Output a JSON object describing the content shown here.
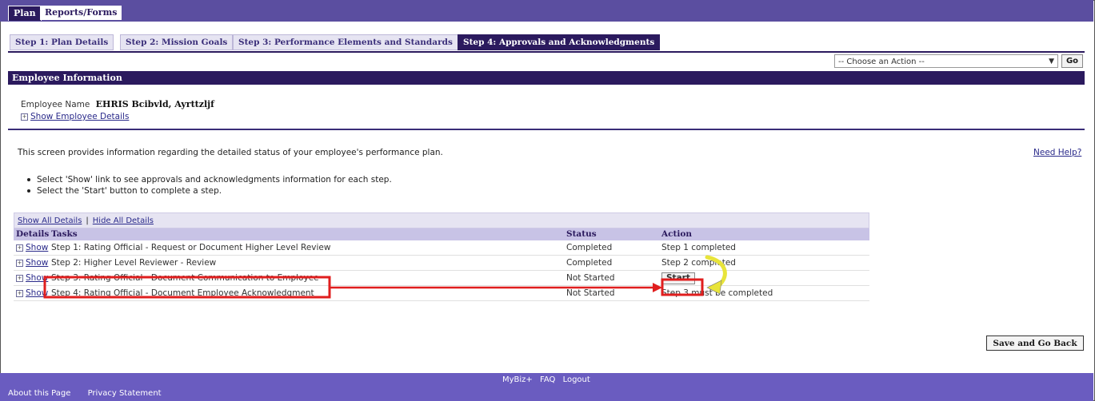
{
  "top_tabs": {
    "plan": "Plan",
    "reports": "Reports/Forms"
  },
  "step_tabs": [
    "Step 1: Plan Details",
    "Step 2: Mission Goals",
    "Step 3: Performance Elements and Standards",
    "Step 4: Approvals and Acknowledgments"
  ],
  "action_select": {
    "value": "-- Choose an Action --",
    "go_label": "Go"
  },
  "section_title": "Employee Information",
  "employee": {
    "label": "Employee Name",
    "name": "EHRIS Bcibvld, Ayrttzljf",
    "details_link": "Show Employee Details"
  },
  "intro_text": "This screen provides information regarding the detailed status of your employee's performance plan.",
  "help_link": "Need Help?",
  "bullets": [
    "Select 'Show' link to see approvals and acknowledgments information for each step.",
    "Select the 'Start' button to complete a step."
  ],
  "grid": {
    "show_all": "Show All Details",
    "hide_all": "Hide All Details",
    "divider": "|",
    "headers": {
      "details": "Details",
      "tasks": "Tasks",
      "status": "Status",
      "action": "Action"
    },
    "show_label": "Show",
    "rows": [
      {
        "task": "Step 1: Rating Official - Request or Document Higher Level Review",
        "status": "Completed",
        "action": "Step 1 completed"
      },
      {
        "task": "Step 2: Higher Level Reviewer - Review",
        "status": "Completed",
        "action": "Step 2 completed"
      },
      {
        "task": "Step 3: Rating Official - Document Communication to Employee",
        "status": "Not Started",
        "action": "Start"
      },
      {
        "task": "Step 4: Rating Official - Document Employee Acknowledgment",
        "status": "Not Started",
        "action": "Step 3 must be completed"
      }
    ]
  },
  "save_button": "Save and Go Back",
  "footer": {
    "center_links": [
      "MyBiz+",
      "FAQ",
      "Logout"
    ],
    "left_links": [
      "About this Page",
      "Privacy Statement"
    ]
  },
  "colors": {
    "header_purple": "#2b1a5e",
    "footer_purple": "#6a5cc0",
    "highlight_red": "#e01e1e",
    "arrow_yellow": "#e8e43a"
  }
}
